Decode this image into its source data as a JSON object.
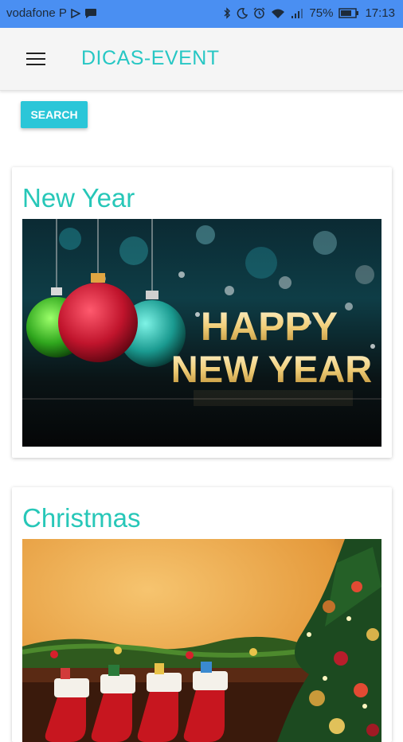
{
  "status_bar": {
    "carrier": "vodafone P",
    "battery": "75%",
    "time": "17:13"
  },
  "app_bar": {
    "title": "DICAS-EVENT"
  },
  "search_button": {
    "label": "SEARCH"
  },
  "events": [
    {
      "title": "New Year",
      "image_text_line1": "HAPPY",
      "image_text_line2": "NEW YEAR"
    },
    {
      "title": "Christmas"
    }
  ],
  "colors": {
    "status_bar": "#4a8ff2",
    "accent": "#27c7c4",
    "button": "#2bc6d8"
  }
}
